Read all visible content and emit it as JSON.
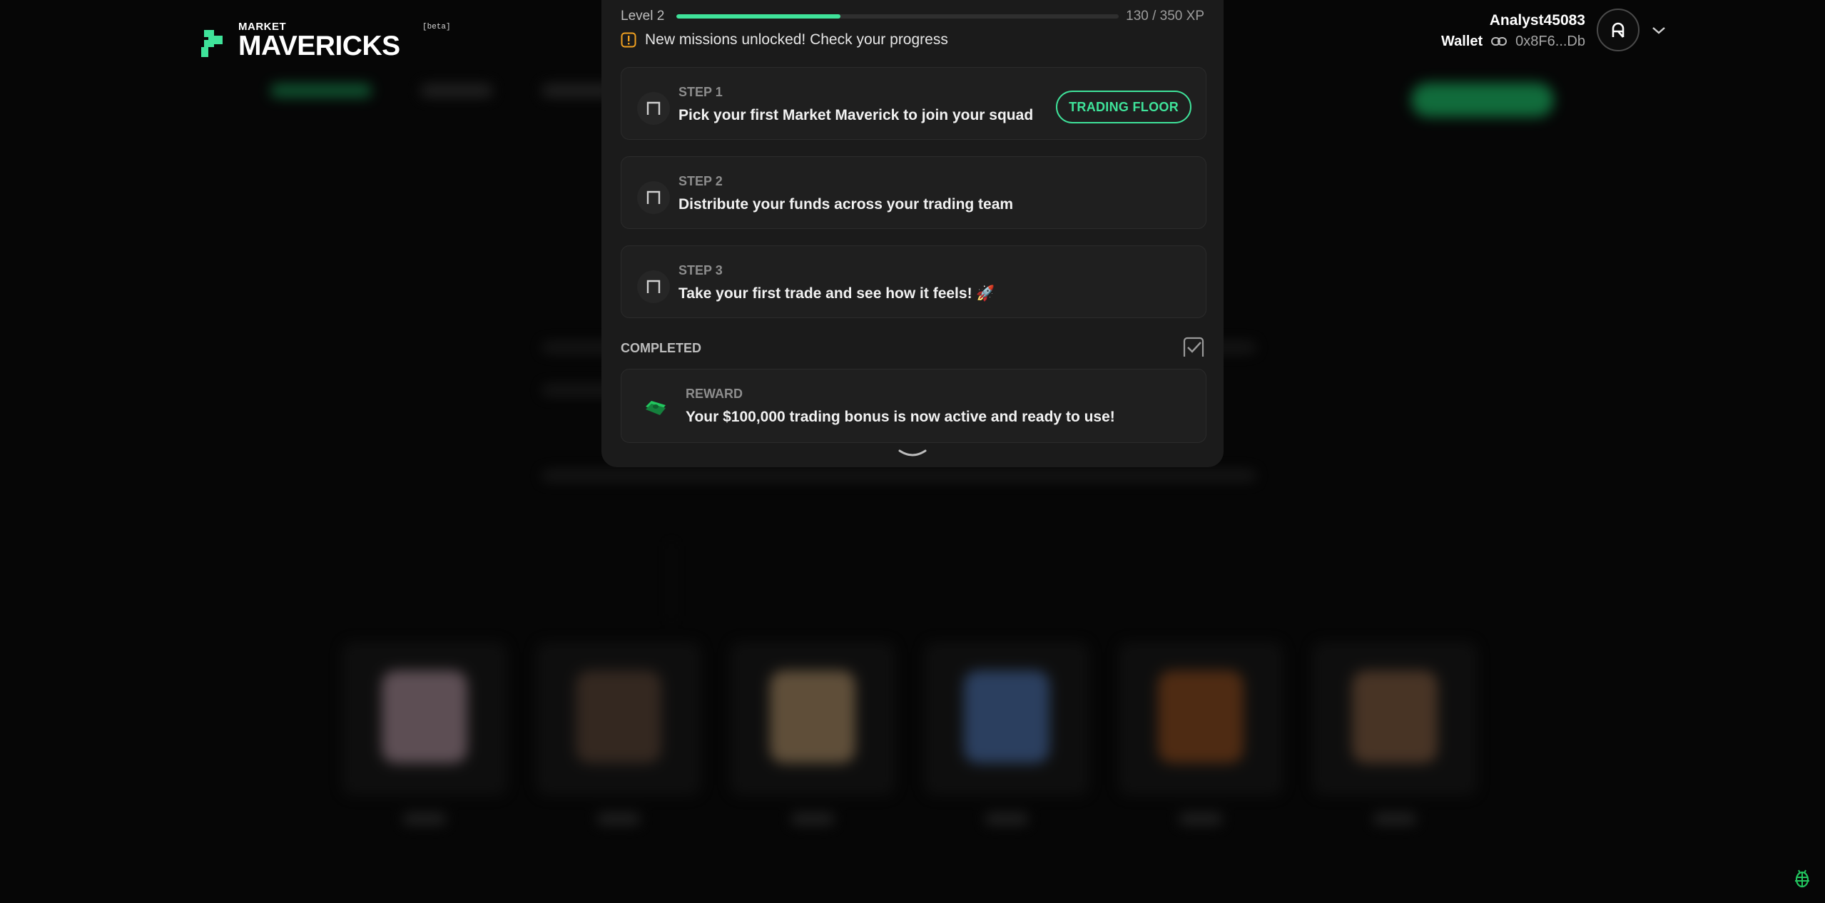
{
  "brand": {
    "name_small": "MARKET",
    "name_big": "MAVERICKS",
    "badge": "[beta]",
    "accent": "#3fe39a"
  },
  "user": {
    "username": "Analyst45083",
    "wallet_label": "Wallet",
    "wallet_address": "0x8F6...Db",
    "avatar_initial": "R",
    "icons": [
      "link-icon",
      "chevron-down-icon"
    ]
  },
  "missions": {
    "level_label": "Level 2",
    "xp_current": 130,
    "xp_total": 350,
    "xp_text": "130 / 350 XP",
    "progress_fraction": 0.371,
    "notice": "New missions unlocked! Check your progress",
    "notice_color": "#f0a020",
    "steps": [
      {
        "label": "STEP 1",
        "text": "Pick your first Market Maverick to join your squad",
        "button": "TRADING FLOOR"
      },
      {
        "label": "STEP 2",
        "text": "Distribute your funds across your trading team"
      },
      {
        "label": "STEP 3",
        "text": "Take your first trade and see how it feels! 🚀"
      }
    ],
    "completed_label": "COMPLETED",
    "reward": {
      "label": "REWARD",
      "text": "Your $100,000 trading bonus is now active and ready to use!"
    }
  }
}
